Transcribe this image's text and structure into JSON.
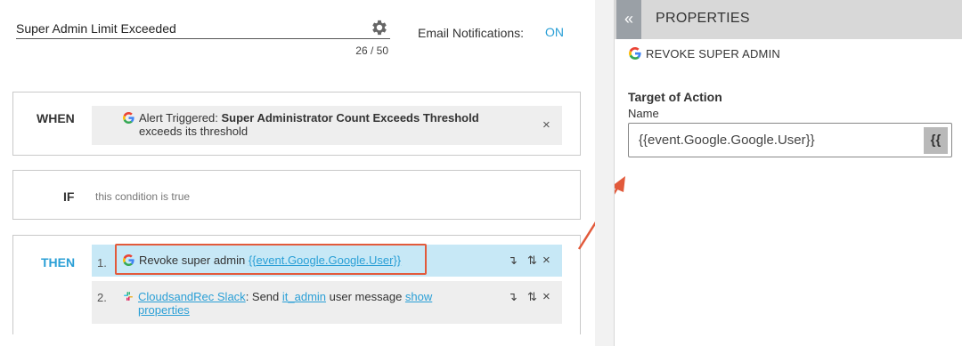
{
  "rule": {
    "name": "Super Admin Limit Exceeded",
    "char_count": "26 / 50",
    "email_label": "Email Notifications:",
    "email_state": "ON"
  },
  "when": {
    "label": "WHEN",
    "alert_prefix": "Alert Triggered: ",
    "alert_name": "Super Administrator Count Exceeds Threshold",
    "alert_suffix": "exceeds its threshold"
  },
  "if": {
    "label": "IF",
    "condition": "this condition is true"
  },
  "then": {
    "label": "THEN",
    "actions": [
      {
        "number": "1.",
        "text": "Revoke super admin ",
        "token": "{{event.Google.Google.User}}"
      },
      {
        "number": "2.",
        "integration": "CloudsandRec Slack",
        "text_mid": ": Send ",
        "channel": "it_admin",
        "text_after": " user message ",
        "show": "show",
        "properties": "properties"
      }
    ]
  },
  "properties": {
    "collapse_glyph": "«",
    "title": "PROPERTIES",
    "action_name": "REVOKE SUPER ADMIN",
    "section_label": "Target of Action",
    "field_label": "Name",
    "field_value": "{{event.Google.Google.User}}",
    "token_button": "{{"
  },
  "icons": {
    "gear": "gear-icon",
    "google": "google-logo-icon",
    "slack": "slack-logo-icon",
    "close": "close-icon",
    "move_down": "move-down-icon",
    "reorder": "reorder-icon",
    "collapse": "collapse-icon"
  },
  "colors": {
    "accent": "#2a9fd6",
    "highlight_border": "#e25a3b",
    "selected_row": "#c7e8f6"
  }
}
